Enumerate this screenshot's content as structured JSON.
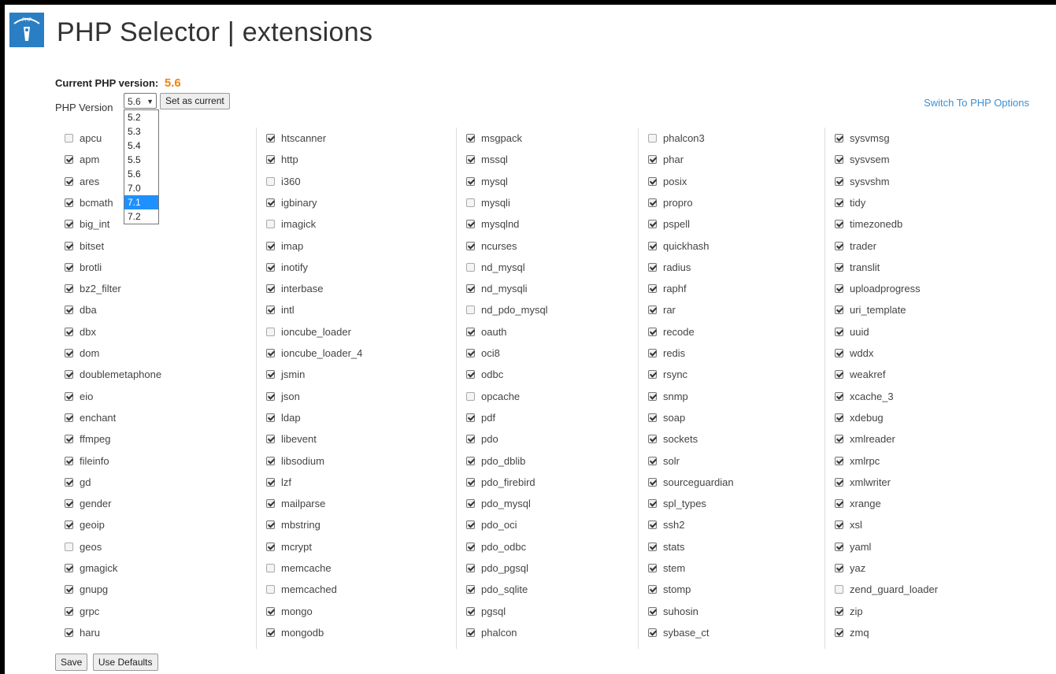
{
  "header": {
    "title": "PHP Selector | extensions",
    "logo_icon": "php-selector-icon"
  },
  "current": {
    "label": "Current PHP version:",
    "value": "5.6"
  },
  "version_select": {
    "label": "PHP Version",
    "selected": "5.6",
    "options": [
      "5.2",
      "5.3",
      "5.4",
      "5.5",
      "5.6",
      "7.0",
      "7.1",
      "7.2"
    ],
    "highlighted": "7.1"
  },
  "set_current_label": "Set as current",
  "switch_link": "Switch To PHP Options",
  "columns": [
    [
      {
        "name": "apcu",
        "checked": false
      },
      {
        "name": "apm",
        "checked": true
      },
      {
        "name": "ares",
        "checked": true
      },
      {
        "name": "bcmath",
        "checked": true
      },
      {
        "name": "big_int",
        "checked": true
      },
      {
        "name": "bitset",
        "checked": true
      },
      {
        "name": "brotli",
        "checked": true
      },
      {
        "name": "bz2_filter",
        "checked": true
      },
      {
        "name": "dba",
        "checked": true
      },
      {
        "name": "dbx",
        "checked": true
      },
      {
        "name": "dom",
        "checked": true
      },
      {
        "name": "doublemetaphone",
        "checked": true
      },
      {
        "name": "eio",
        "checked": true
      },
      {
        "name": "enchant",
        "checked": true
      },
      {
        "name": "ffmpeg",
        "checked": true
      },
      {
        "name": "fileinfo",
        "checked": true
      },
      {
        "name": "gd",
        "checked": true
      },
      {
        "name": "gender",
        "checked": true
      },
      {
        "name": "geoip",
        "checked": true
      },
      {
        "name": "geos",
        "checked": false
      },
      {
        "name": "gmagick",
        "checked": true
      },
      {
        "name": "gnupg",
        "checked": true
      },
      {
        "name": "grpc",
        "checked": true
      },
      {
        "name": "haru",
        "checked": true
      }
    ],
    [
      {
        "name": "htscanner",
        "checked": true
      },
      {
        "name": "http",
        "checked": true
      },
      {
        "name": "i360",
        "checked": false
      },
      {
        "name": "igbinary",
        "checked": true
      },
      {
        "name": "imagick",
        "checked": false
      },
      {
        "name": "imap",
        "checked": true
      },
      {
        "name": "inotify",
        "checked": true
      },
      {
        "name": "interbase",
        "checked": true
      },
      {
        "name": "intl",
        "checked": true
      },
      {
        "name": "ioncube_loader",
        "checked": false
      },
      {
        "name": "ioncube_loader_4",
        "checked": true
      },
      {
        "name": "jsmin",
        "checked": true
      },
      {
        "name": "json",
        "checked": true
      },
      {
        "name": "ldap",
        "checked": true
      },
      {
        "name": "libevent",
        "checked": true
      },
      {
        "name": "libsodium",
        "checked": true
      },
      {
        "name": "lzf",
        "checked": true
      },
      {
        "name": "mailparse",
        "checked": true
      },
      {
        "name": "mbstring",
        "checked": true
      },
      {
        "name": "mcrypt",
        "checked": true
      },
      {
        "name": "memcache",
        "checked": false
      },
      {
        "name": "memcached",
        "checked": false
      },
      {
        "name": "mongo",
        "checked": true
      },
      {
        "name": "mongodb",
        "checked": true
      }
    ],
    [
      {
        "name": "msgpack",
        "checked": true
      },
      {
        "name": "mssql",
        "checked": true
      },
      {
        "name": "mysql",
        "checked": true
      },
      {
        "name": "mysqli",
        "checked": false
      },
      {
        "name": "mysqlnd",
        "checked": true
      },
      {
        "name": "ncurses",
        "checked": true
      },
      {
        "name": "nd_mysql",
        "checked": false
      },
      {
        "name": "nd_mysqli",
        "checked": true
      },
      {
        "name": "nd_pdo_mysql",
        "checked": false
      },
      {
        "name": "oauth",
        "checked": true
      },
      {
        "name": "oci8",
        "checked": true
      },
      {
        "name": "odbc",
        "checked": true
      },
      {
        "name": "opcache",
        "checked": false
      },
      {
        "name": "pdf",
        "checked": true
      },
      {
        "name": "pdo",
        "checked": true
      },
      {
        "name": "pdo_dblib",
        "checked": true
      },
      {
        "name": "pdo_firebird",
        "checked": true
      },
      {
        "name": "pdo_mysql",
        "checked": true
      },
      {
        "name": "pdo_oci",
        "checked": true
      },
      {
        "name": "pdo_odbc",
        "checked": true
      },
      {
        "name": "pdo_pgsql",
        "checked": true
      },
      {
        "name": "pdo_sqlite",
        "checked": true
      },
      {
        "name": "pgsql",
        "checked": true
      },
      {
        "name": "phalcon",
        "checked": true
      }
    ],
    [
      {
        "name": "phalcon3",
        "checked": false
      },
      {
        "name": "phar",
        "checked": true
      },
      {
        "name": "posix",
        "checked": true
      },
      {
        "name": "propro",
        "checked": true
      },
      {
        "name": "pspell",
        "checked": true
      },
      {
        "name": "quickhash",
        "checked": true
      },
      {
        "name": "radius",
        "checked": true
      },
      {
        "name": "raphf",
        "checked": true
      },
      {
        "name": "rar",
        "checked": true
      },
      {
        "name": "recode",
        "checked": true
      },
      {
        "name": "redis",
        "checked": true
      },
      {
        "name": "rsync",
        "checked": true
      },
      {
        "name": "snmp",
        "checked": true
      },
      {
        "name": "soap",
        "checked": true
      },
      {
        "name": "sockets",
        "checked": true
      },
      {
        "name": "solr",
        "checked": true
      },
      {
        "name": "sourceguardian",
        "checked": true
      },
      {
        "name": "spl_types",
        "checked": true
      },
      {
        "name": "ssh2",
        "checked": true
      },
      {
        "name": "stats",
        "checked": true
      },
      {
        "name": "stem",
        "checked": true
      },
      {
        "name": "stomp",
        "checked": true
      },
      {
        "name": "suhosin",
        "checked": true
      },
      {
        "name": "sybase_ct",
        "checked": true
      }
    ],
    [
      {
        "name": "sysvmsg",
        "checked": true
      },
      {
        "name": "sysvsem",
        "checked": true
      },
      {
        "name": "sysvshm",
        "checked": true
      },
      {
        "name": "tidy",
        "checked": true
      },
      {
        "name": "timezonedb",
        "checked": true
      },
      {
        "name": "trader",
        "checked": true
      },
      {
        "name": "translit",
        "checked": true
      },
      {
        "name": "uploadprogress",
        "checked": true
      },
      {
        "name": "uri_template",
        "checked": true
      },
      {
        "name": "uuid",
        "checked": true
      },
      {
        "name": "wddx",
        "checked": true
      },
      {
        "name": "weakref",
        "checked": true
      },
      {
        "name": "xcache_3",
        "checked": true
      },
      {
        "name": "xdebug",
        "checked": true
      },
      {
        "name": "xmlreader",
        "checked": true
      },
      {
        "name": "xmlrpc",
        "checked": true
      },
      {
        "name": "xmlwriter",
        "checked": true
      },
      {
        "name": "xrange",
        "checked": true
      },
      {
        "name": "xsl",
        "checked": true
      },
      {
        "name": "yaml",
        "checked": true
      },
      {
        "name": "yaz",
        "checked": true
      },
      {
        "name": "zend_guard_loader",
        "checked": false
      },
      {
        "name": "zip",
        "checked": true
      },
      {
        "name": "zmq",
        "checked": true
      }
    ]
  ],
  "buttons": {
    "save": "Save",
    "defaults": "Use Defaults"
  },
  "colors": {
    "accent_version": "#f0830f",
    "link": "#3a8fd6",
    "dropdown_highlight": "#1e90ff"
  }
}
